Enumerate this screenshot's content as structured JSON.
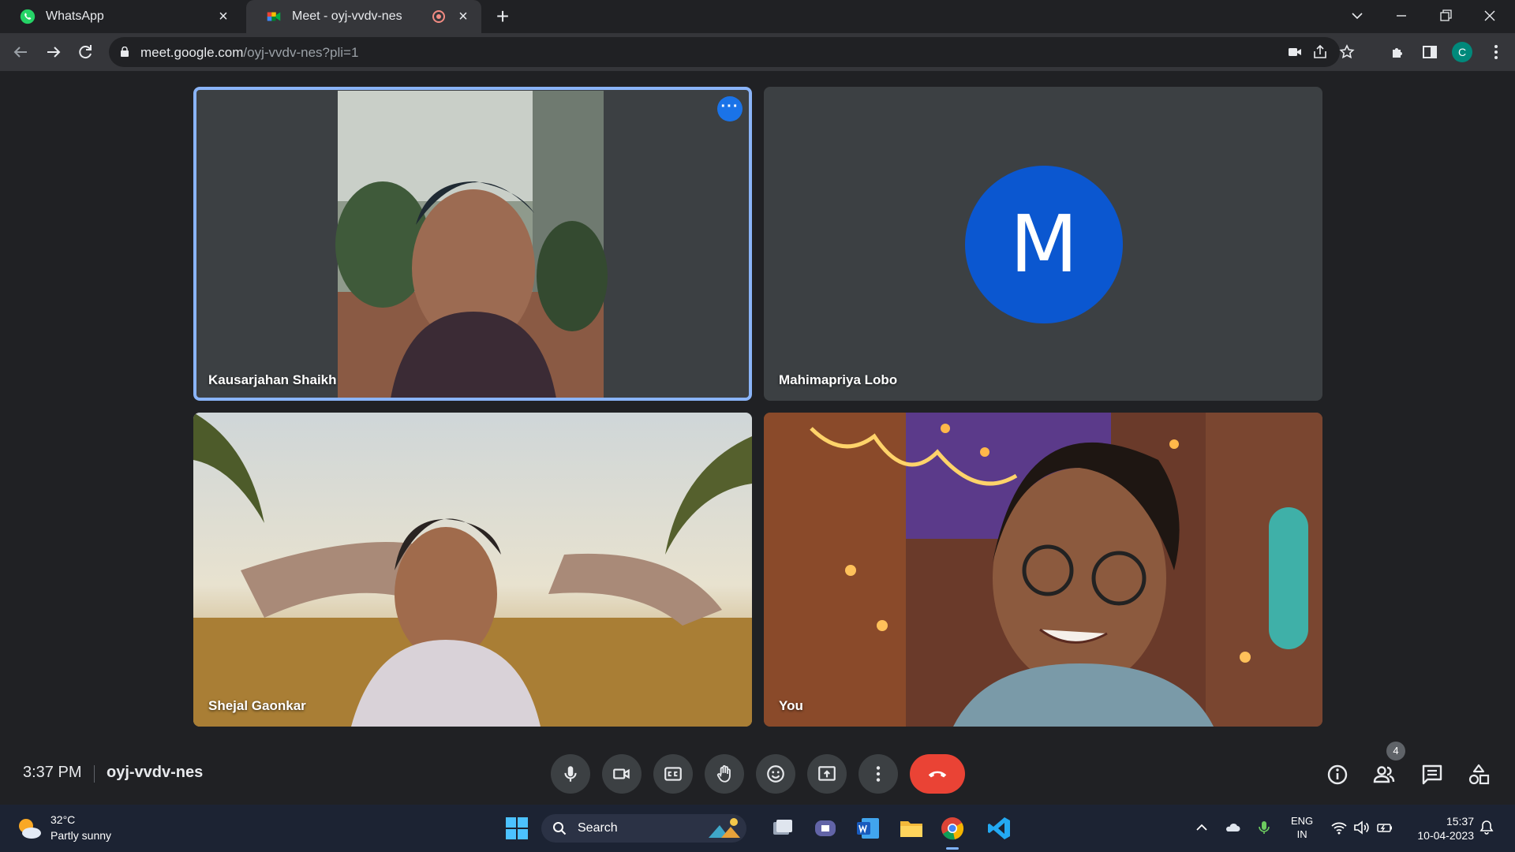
{
  "browser": {
    "tabs": [
      {
        "title": "WhatsApp"
      },
      {
        "title": "Meet - oyj-vvdv-nes"
      }
    ],
    "url_host": "meet.google.com",
    "url_path": "/oyj-vvdv-nes?pli=1",
    "profile_initial": "C"
  },
  "meet": {
    "tiles": [
      {
        "name": "Kausarjahan Shaikh",
        "speaking": true
      },
      {
        "name": "Mahimapriya Lobo",
        "avatar_letter": "M",
        "avatar_color": "#0b57d0"
      },
      {
        "name": "Shejal Gaonkar"
      },
      {
        "name": "You"
      }
    ],
    "time": "3:37 PM",
    "meeting_code": "oyj-vvdv-nes",
    "participant_count": "4",
    "accent": "#8ab4f8",
    "hangup_color": "#ea4335"
  },
  "taskbar": {
    "weather_temp": "32°C",
    "weather_desc": "Partly sunny",
    "search_label": "Search",
    "lang_line1": "ENG",
    "lang_line2": "IN",
    "clock_time": "15:37",
    "clock_date": "10-04-2023"
  }
}
